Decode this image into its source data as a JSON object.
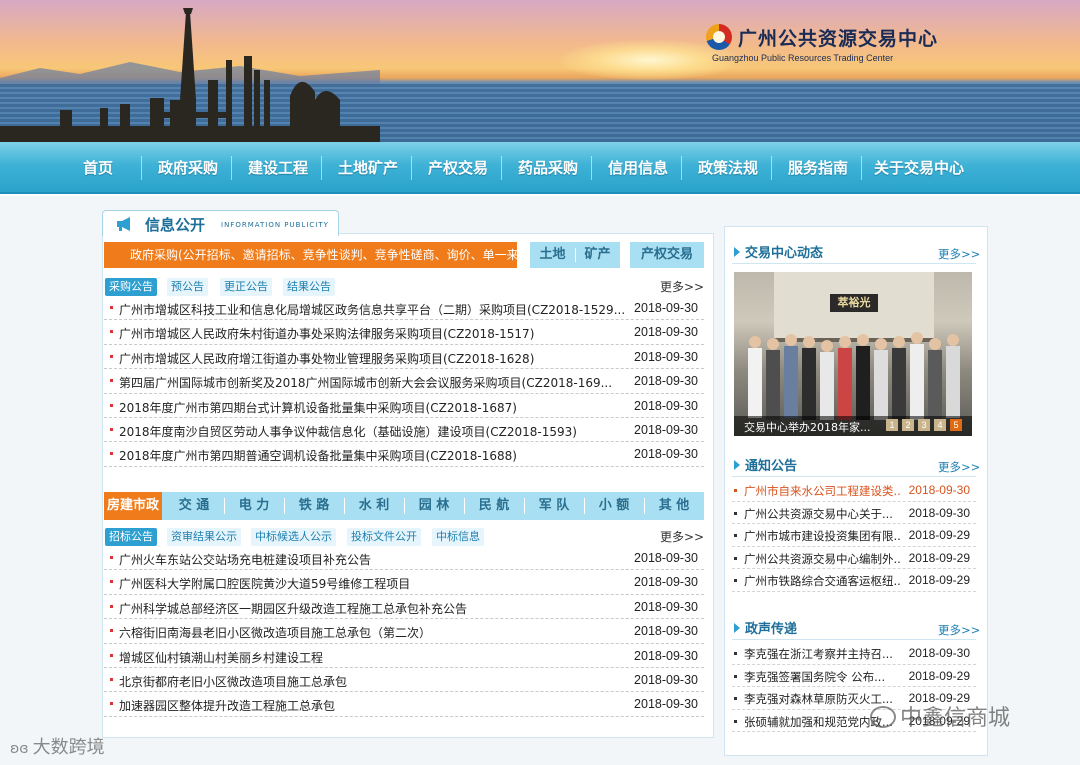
{
  "header": {
    "logo_cn": "广州公共资源交易中心",
    "logo_en": "Guangzhou Public Resources Trading Center"
  },
  "nav": [
    "首页",
    "政府采购",
    "建设工程",
    "土地矿产",
    "产权交易",
    "药品采购",
    "信用信息",
    "政策法规",
    "服务指南",
    "关于交易中心"
  ],
  "info": {
    "title_cn": "信息公开",
    "title_en": "INFORMATION PUBLICITY",
    "procurement": {
      "category_label": "政府采购(公开招标、邀请招标、竞争性谈判、竞争性磋商、询价、单一来源)",
      "side_buttons": [
        "土地",
        "矿产",
        "产权交易"
      ],
      "tabs": [
        "采购公告",
        "预公告",
        "更正公告",
        "结果公告"
      ],
      "more": "更多>>",
      "items": [
        {
          "title": "广州市增城区科技工业和信息化局增城区政务信息共享平台（二期）采购项目(CZ2018-1529...",
          "date": "2018-09-30"
        },
        {
          "title": "广州市增城区人民政府朱村街道办事处采购法律服务采购项目(CZ2018-1517)",
          "date": "2018-09-30"
        },
        {
          "title": "广州市增城区人民政府增江街道办事处物业管理服务采购项目(CZ2018-1628)",
          "date": "2018-09-30"
        },
        {
          "title": "第四届广州国际城市创新奖及2018广州国际城市创新大会会议服务采购项目(CZ2018-169...",
          "date": "2018-09-30"
        },
        {
          "title": "2018年度广州市第四期台式计算机设备批量集中采购项目(CZ2018-1687)",
          "date": "2018-09-30"
        },
        {
          "title": "2018年度南沙自贸区劳动人事争议仲裁信息化（基础设施）建设项目(CZ2018-1593)",
          "date": "2018-09-30"
        },
        {
          "title": "2018年度广州市第四期普通空调机设备批量集中采购项目(CZ2018-1688)",
          "date": "2018-09-30"
        }
      ]
    },
    "construction": {
      "categories": [
        "房建市政",
        "交 通",
        "电 力",
        "铁 路",
        "水 利",
        "园 林",
        "民 航",
        "军 队",
        "小 额",
        "其 他"
      ],
      "tabs": [
        "招标公告",
        "资审结果公示",
        "中标候选人公示",
        "投标文件公开",
        "中标信息"
      ],
      "more": "更多>>",
      "items": [
        {
          "title": "广州火车东站公交站场充电桩建设项目补充公告",
          "date": "2018-09-30"
        },
        {
          "title": "广州医科大学附属口腔医院黄沙大道59号维修工程项目",
          "date": "2018-09-30"
        },
        {
          "title": "广州科学城总部经济区一期园区升级改造工程施工总承包补充公告",
          "date": "2018-09-30"
        },
        {
          "title": "六榕街旧南海县老旧小区微改造项目施工总承包（第二次）",
          "date": "2018-09-30"
        },
        {
          "title": "增城区仙村镇潮山村美丽乡村建设工程",
          "date": "2018-09-30"
        },
        {
          "title": "北京街都府老旧小区微改造项目施工总承包",
          "date": "2018-09-30"
        },
        {
          "title": "加速器园区整体提升改造工程施工总承包",
          "date": "2018-09-30"
        }
      ]
    }
  },
  "dynamics": {
    "title": "交易中心动态",
    "more": "更多>>",
    "photo_sign": "萃裕光",
    "caption": "交易中心举办2018年家...",
    "pages": [
      "1",
      "2",
      "3",
      "4",
      "5"
    ],
    "active_page": "5"
  },
  "notices": {
    "title": "通知公告",
    "more": "更多>>",
    "items": [
      {
        "title": "广州市自来水公司工程建设类...",
        "date": "2018-09-30"
      },
      {
        "title": "广州公共资源交易中心关于...",
        "date": "2018-09-30"
      },
      {
        "title": "广州市城市建设投资集团有限...",
        "date": "2018-09-29"
      },
      {
        "title": "广州公共资源交易中心编制外...",
        "date": "2018-09-29"
      },
      {
        "title": "广州市铁路综合交通客运枢纽...",
        "date": "2018-09-29"
      }
    ]
  },
  "gov": {
    "title": "政声传递",
    "more": "更多>>",
    "items": [
      {
        "title": "李克强在浙江考察并主持召...",
        "date": "2018-09-30"
      },
      {
        "title": "李克强签署国务院令 公布...",
        "date": "2018-09-29"
      },
      {
        "title": "李克强对森林草原防灭火工...",
        "date": "2018-09-29"
      },
      {
        "title": "张硕辅就加强和规范党内政...",
        "date": "2018-09-29"
      }
    ]
  },
  "watermarks": {
    "right": "中鑫信商城",
    "left": "大数跨境"
  },
  "colors": {
    "nav": "#2aa3cc",
    "accent_orange": "#f07b1a",
    "tab_blue": "#a9dff2",
    "highlight": "#d9531e"
  }
}
